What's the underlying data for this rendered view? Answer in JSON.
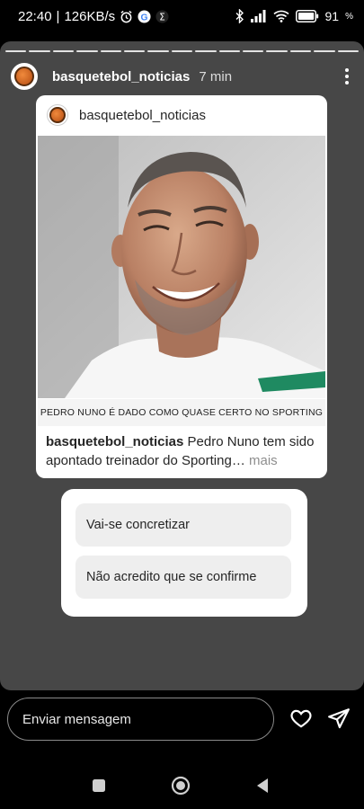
{
  "status": {
    "time": "22:40",
    "speed": "126KB/s",
    "battery": "91"
  },
  "story": {
    "username": "basquetebol_noticias",
    "time_ago": "7 min"
  },
  "post": {
    "username": "basquetebol_noticias",
    "image_caption": "PEDRO NUNO É DADO COMO QUASE CERTO NO SPORTING",
    "caption_user": "basquetebol_noticias",
    "caption_text": " Pedro Nuno tem sido apontado treinador do Sporting",
    "caption_ellipsis": "…",
    "more_label": " mais"
  },
  "poll": {
    "options": [
      "Vai-se concretizar",
      "Não acredito que se confirme"
    ]
  },
  "composer": {
    "placeholder": "Enviar mensagem"
  }
}
